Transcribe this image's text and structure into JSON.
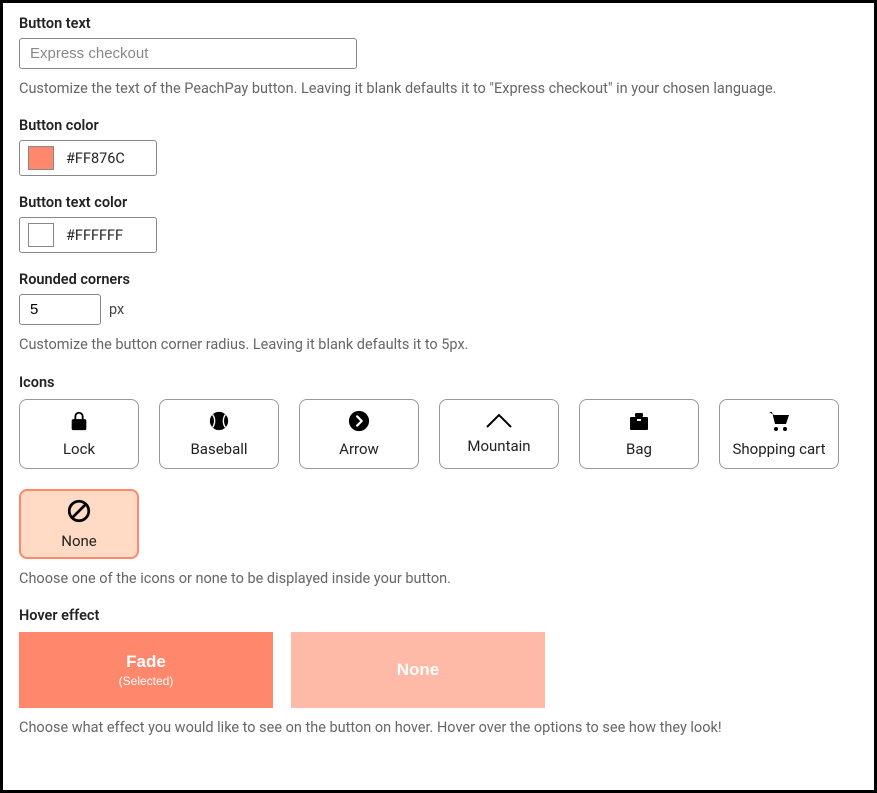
{
  "buttonText": {
    "label": "Button text",
    "placeholder": "Express checkout",
    "description": "Customize the text of the PeachPay button. Leaving it blank defaults it to \"Express checkout\" in your chosen language."
  },
  "buttonColor": {
    "label": "Button color",
    "value": "#FF876C",
    "swatch": "#FF876C"
  },
  "buttonTextColor": {
    "label": "Button text color",
    "value": "#FFFFFF",
    "swatch": "#FFFFFF"
  },
  "roundedCorners": {
    "label": "Rounded corners",
    "value": "5",
    "unit": "px",
    "description": "Customize the button corner radius. Leaving it blank defaults it to 5px."
  },
  "icons": {
    "label": "Icons",
    "options": [
      {
        "name": "Lock"
      },
      {
        "name": "Baseball"
      },
      {
        "name": "Arrow"
      },
      {
        "name": "Mountain"
      },
      {
        "name": "Bag"
      },
      {
        "name": "Shopping cart"
      },
      {
        "name": "None",
        "selected": true
      }
    ],
    "description": "Choose one of the icons or none to be displayed inside your button."
  },
  "hoverEffect": {
    "label": "Hover effect",
    "fade": {
      "label": "Fade",
      "sub": "(Selected)"
    },
    "none": {
      "label": "None"
    },
    "description": "Choose what effect you would like to see on the button on hover. Hover over the options to see how they look!"
  }
}
